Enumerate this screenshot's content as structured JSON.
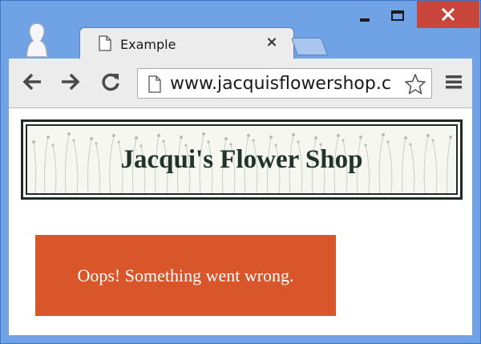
{
  "window": {
    "controls": {
      "minimize_icon": "minimize-icon",
      "maximize_icon": "maximize-icon",
      "close_icon": "close-icon"
    },
    "close_color": "#c9463c",
    "frame_color": "#6fa3e6"
  },
  "tab": {
    "title": "Example",
    "close_glyph": "×"
  },
  "toolbar": {
    "url": "www.jacquisflowershop.c"
  },
  "page": {
    "banner_title": "Jacqui's Flower Shop",
    "error_message": "Oops! Something went wrong.",
    "error_color": "#d9552a"
  }
}
